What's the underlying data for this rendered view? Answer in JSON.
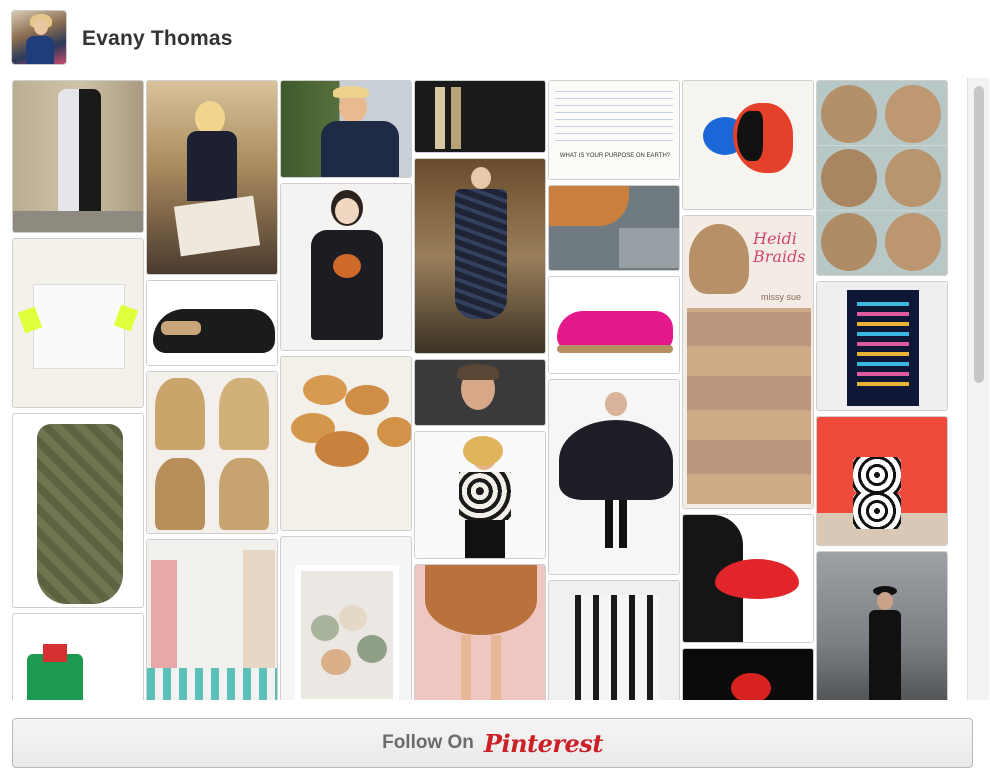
{
  "profile": {
    "name": "Evany Thomas"
  },
  "follow_button": {
    "prefix": "Follow On",
    "brand": "Pinterest"
  },
  "pins": {
    "quote_card": {
      "caption": "WHAT IS YOUR PURPOSE ON EARTH?"
    },
    "braids_card": {
      "title": "Heidi Braids",
      "subtitle": "missy sue"
    }
  }
}
